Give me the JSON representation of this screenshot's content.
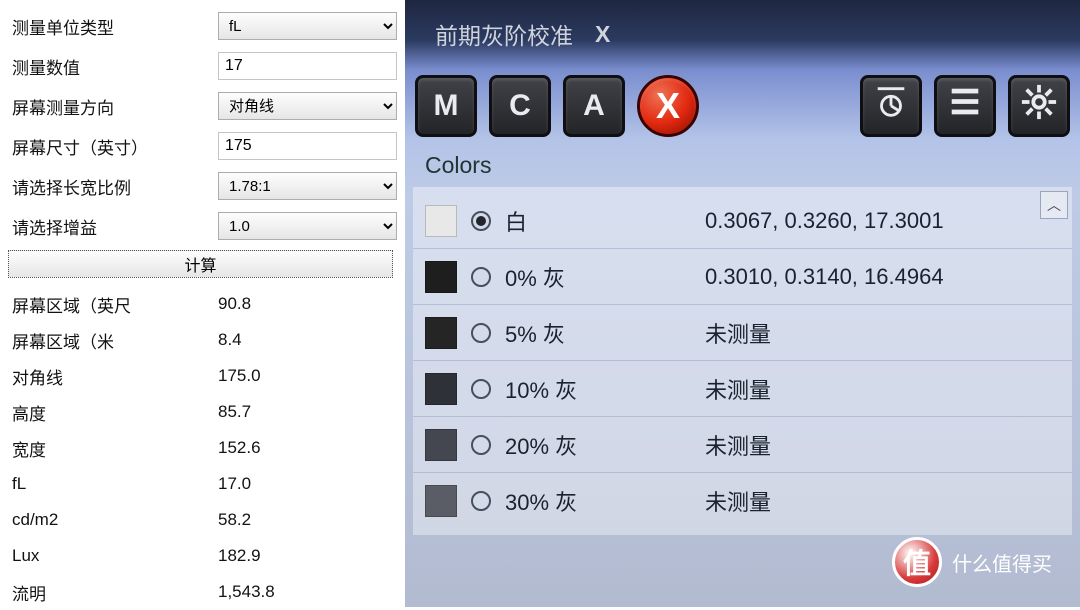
{
  "left": {
    "fields": [
      {
        "label": "测量单位类型",
        "type": "select",
        "value": "fL"
      },
      {
        "label": "测量数值",
        "type": "text",
        "value": "17"
      },
      {
        "label": "屏幕测量方向",
        "type": "select",
        "value": "对角线"
      },
      {
        "label": "屏幕尺寸（英寸）",
        "type": "text",
        "value": "175"
      },
      {
        "label": "请选择长宽比例",
        "type": "select",
        "value": "1.78:1"
      },
      {
        "label": "请选择增益",
        "type": "select",
        "value": "1.0"
      }
    ],
    "calc_button": "计算",
    "results": [
      {
        "label": "屏幕区域（英尺",
        "value": "90.8"
      },
      {
        "label": "屏幕区域（米",
        "value": "8.4"
      },
      {
        "label": "对角线",
        "value": "175.0"
      },
      {
        "label": "高度",
        "value": "85.7"
      },
      {
        "label": "宽度",
        "value": "152.6"
      },
      {
        "label": "fL",
        "value": "17.0"
      },
      {
        "label": "cd/m2",
        "value": "58.2"
      },
      {
        "label": "Lux",
        "value": "182.9"
      },
      {
        "label": "流明",
        "value": "1,543.8"
      }
    ]
  },
  "right": {
    "tab_title": "前期灰阶校准",
    "tab_close": "X",
    "toolbar": {
      "letters": [
        "M",
        "C",
        "A"
      ],
      "close_x": "X"
    },
    "section_title": "Colors",
    "rows": [
      {
        "swatch": "#e8e8e8",
        "selected": true,
        "name": "白",
        "value": "0.3067, 0.3260, 17.3001"
      },
      {
        "swatch": "#1e1e1e",
        "selected": false,
        "name": "0% 灰",
        "value": "0.3010, 0.3140, 16.4964"
      },
      {
        "swatch": "#252525",
        "selected": false,
        "name": "5% 灰",
        "value": "未测量"
      },
      {
        "swatch": "#2f3138",
        "selected": false,
        "name": "10% 灰",
        "value": "未测量"
      },
      {
        "swatch": "#44474f",
        "selected": false,
        "name": "20% 灰",
        "value": "未测量"
      },
      {
        "swatch": "#5a5d66",
        "selected": false,
        "name": "30% 灰",
        "value": "未测量"
      }
    ]
  },
  "watermark": {
    "glyph": "值",
    "text": "什么值得买"
  }
}
